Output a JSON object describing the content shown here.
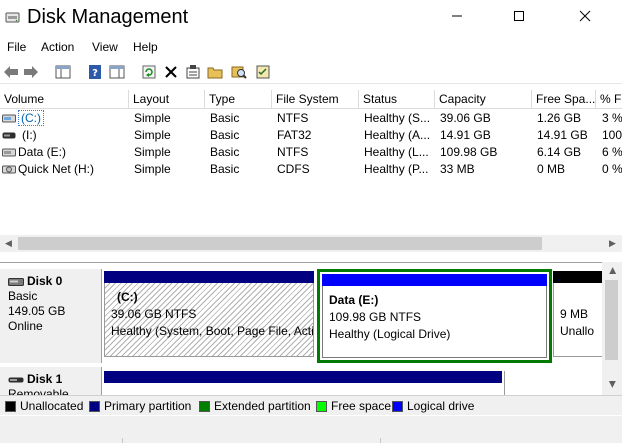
{
  "window": {
    "title": "Disk Management"
  },
  "menu": [
    "File",
    "Action",
    "View",
    "Help"
  ],
  "columns": [
    "Volume",
    "Layout",
    "Type",
    "File System",
    "Status",
    "Capacity",
    "Free Spa...",
    "% F"
  ],
  "volumes": [
    {
      "name": "(C:)",
      "layout": "Simple",
      "type": "Basic",
      "fs": "NTFS",
      "status": "Healthy (S...",
      "capacity": "39.06 GB",
      "free": "1.26 GB",
      "pct": "3 %",
      "icon": "hard-drive-icon"
    },
    {
      "name": "(I:)",
      "layout": "Simple",
      "type": "Basic",
      "fs": "FAT32",
      "status": "Healthy (A...",
      "capacity": "14.91 GB",
      "free": "14.91 GB",
      "pct": "100",
      "icon": "removable-drive-icon"
    },
    {
      "name": "Data (E:)",
      "layout": "Simple",
      "type": "Basic",
      "fs": "NTFS",
      "status": "Healthy (L...",
      "capacity": "109.98 GB",
      "free": "6.14 GB",
      "pct": "6 %",
      "icon": "hard-drive-icon"
    },
    {
      "name": "Quick Net (H:)",
      "layout": "Simple",
      "type": "Basic",
      "fs": "CDFS",
      "status": "Healthy (P...",
      "capacity": "33 MB",
      "free": "0 MB",
      "pct": "0 %",
      "icon": "cd-drive-icon"
    }
  ],
  "disks": [
    {
      "title": "Disk 0",
      "type": "Basic",
      "size": "149.05 GB",
      "state": "Online",
      "partitions": [
        {
          "name": "(C:)",
          "size": "39.06 GB NTFS",
          "status": "Healthy (System, Boot, Page File, Acti"
        },
        {
          "name": "Data  (E:)",
          "size": "109.98 GB NTFS",
          "status": "Healthy (Logical Drive)"
        },
        {
          "name": "",
          "size": "9 MB",
          "status": "Unallo"
        }
      ]
    },
    {
      "title": "Disk 1",
      "type": "Removable"
    }
  ],
  "legend": [
    {
      "label": "Unallocated",
      "color": "#000000"
    },
    {
      "label": "Primary partition",
      "color": "#000080"
    },
    {
      "label": "Extended partition",
      "color": "#008000"
    },
    {
      "label": "Free space",
      "color": "#00ff00"
    },
    {
      "label": "Logical drive",
      "color": "#0000ff"
    }
  ],
  "colors": {
    "primary": "#000080",
    "logical": "#0000ff",
    "extended": "#007a00",
    "unallocated": "#000000",
    "selection": "#0063b1"
  }
}
